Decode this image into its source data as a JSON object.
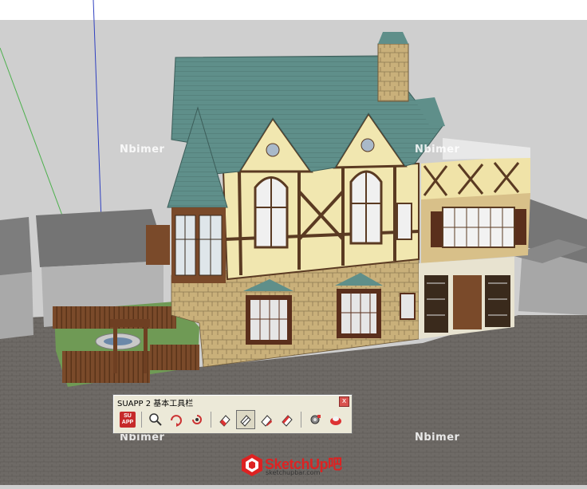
{
  "toolbar": {
    "title": "SUAPP 2 基本工具栏",
    "close_label": "x",
    "suapp_badge_top": "SU",
    "suapp_badge_bottom": "APP",
    "icons": [
      "suapp-logo-icon",
      "zoom-icon",
      "orbit-icon",
      "pan-icon",
      "erase-icon",
      "select-icon",
      "rectangle-icon",
      "paint-icon",
      "settings-icon",
      "help-icon"
    ]
  },
  "watermarks": {
    "left": "Nbimer",
    "right_top": "Nbimer",
    "left_bottom": "Nbimer",
    "right_bottom": "Nbimer"
  },
  "logo": {
    "text": "SketchUp吧",
    "url": "sketchupbar.com"
  },
  "colors": {
    "roof": "#5f8f8a",
    "half_timber": "#f1e7b0",
    "beam": "#5a3a22",
    "stone": "#cbb57e",
    "ground": "#6f6b66",
    "sky": "#cfcfcf"
  }
}
